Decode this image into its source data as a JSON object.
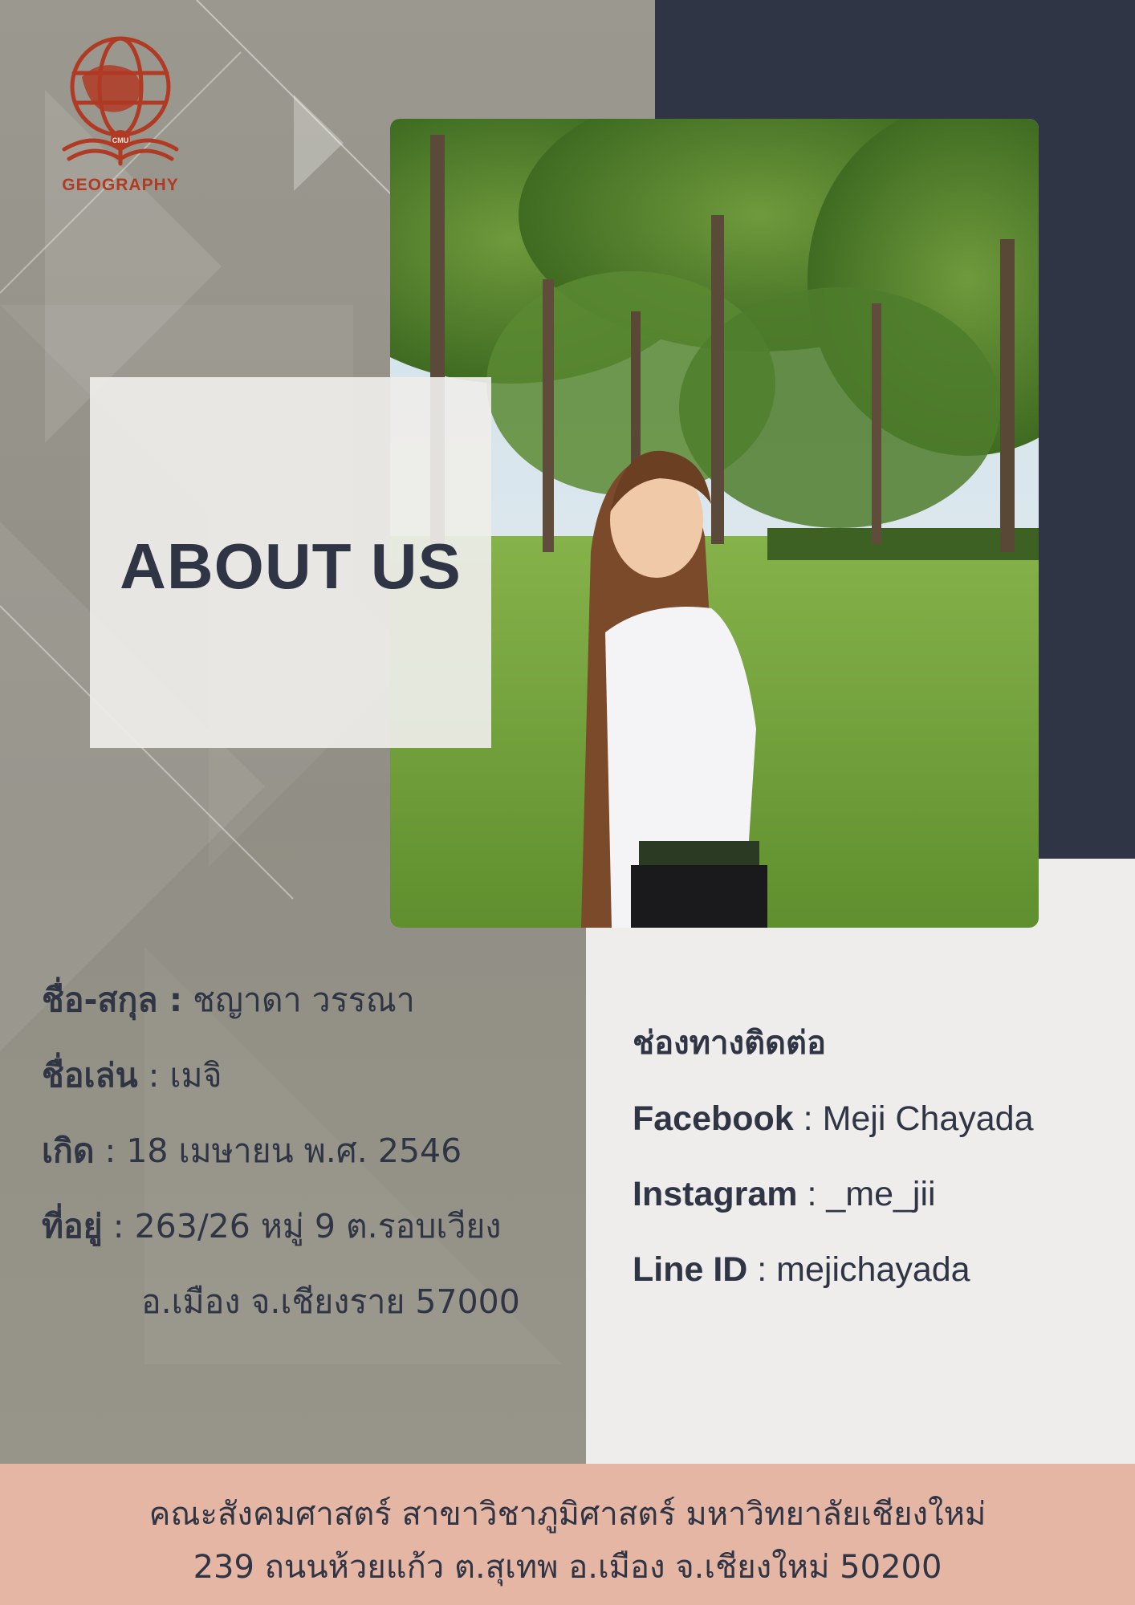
{
  "logo": {
    "word": "GEOGRAPHY",
    "badge": "CMU",
    "color": "#b03a24"
  },
  "heading": "ABOUT US",
  "profile": {
    "name": {
      "label": "ชื่อ-สกุล :",
      "value": "ชญาดา วรรณา"
    },
    "nickname": {
      "label": "ชื่อเล่น",
      "value": " : เมจิ"
    },
    "birth": {
      "label": "เกิด",
      "value": " : 18 เมษายน พ.ศ. 2546"
    },
    "address": {
      "label": "ที่อยู่",
      "value": " : 263/26 หมู่ 9 ต.รอบเวียง",
      "line2": "อ.เมือง จ.เชียงราย 57000"
    }
  },
  "contact": {
    "title": "ช่องทางติดต่อ",
    "items": [
      {
        "label": "Facebook",
        "value": " : Meji Chayada"
      },
      {
        "label": "Instagram",
        "value": " : _me_jii"
      },
      {
        "label": "Line ID",
        "value": " : mejichayada"
      }
    ]
  },
  "footer": {
    "line1": "คณะสังคมศาสตร์ สาขาวิชาภูมิศาสตร์ มหาวิทยาลัยเชียงใหม่",
    "line2": "239 ถนนห้วยแก้ว ต.สุเทพ อ.เมือง จ.เชียงใหม่ 50200"
  },
  "colors": {
    "navy": "#2f3545",
    "taupe": "#9a978d",
    "light": "#eeedeb",
    "peach": "#e5b6a3"
  }
}
